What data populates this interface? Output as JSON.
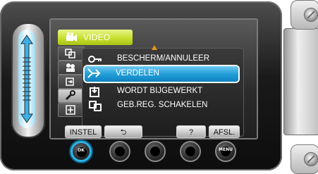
{
  "screen": {
    "top_tab": {
      "label": "VIDEO",
      "icon": "video-camera-icon",
      "accent": "#c6e02d"
    },
    "left_tabs": [
      {
        "icon": "copy-icon"
      },
      {
        "icon": "people-icon"
      },
      {
        "icon": "export-icon"
      },
      {
        "icon": "wrench-icon",
        "active": true
      },
      {
        "icon": "grid-add-icon"
      }
    ],
    "menu": {
      "items": [
        {
          "icon": "key-icon",
          "label": "BESCHERM/ANNULEER"
        },
        {
          "icon": "distribute-icon",
          "label": "VERDELEN",
          "selected": true
        },
        {
          "icon": "update-icon",
          "label": "WORDT BIJGEWERKT"
        },
        {
          "icon": "switch-media-icon",
          "label": "GEB.REG. SCHAKELEN"
        }
      ],
      "selected_color": "#229fd8"
    },
    "softkeys": {
      "instel": "INSTEL",
      "back": "⮌",
      "help": "?",
      "afsl": "AFSL."
    }
  },
  "buttons": {
    "ok": "OK",
    "menu": "MENU"
  }
}
